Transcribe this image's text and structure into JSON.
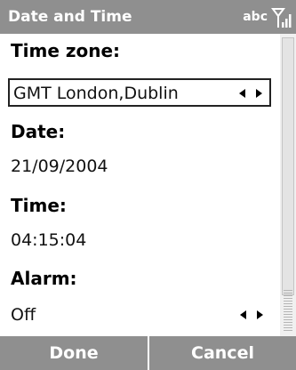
{
  "header": {
    "title": "Date and Time",
    "input_mode": "abc",
    "signal_icon": "signal-strength-icon"
  },
  "fields": {
    "time_zone": {
      "label": "Time zone:",
      "value": "GMT London,Dublin"
    },
    "date": {
      "label": "Date:",
      "value": "21/09/2004"
    },
    "time": {
      "label": "Time:",
      "value": "04:15:04"
    },
    "alarm": {
      "label": "Alarm:",
      "value": "Off"
    }
  },
  "softkeys": {
    "left": "Done",
    "right": "Cancel"
  },
  "colors": {
    "bar_background": "#8f8f8f",
    "bar_text": "#ffffff",
    "content_background": "#ffffff"
  }
}
